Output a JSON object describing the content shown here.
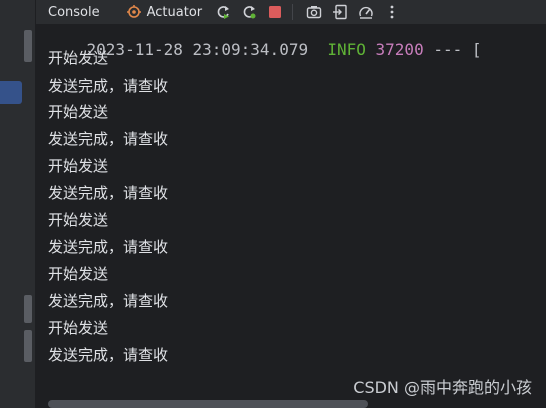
{
  "toolbar": {
    "console_label": "Console",
    "actuator_label": "Actuator"
  },
  "log_header": {
    "timestamp": "2023-11-28 23:09:34.079",
    "level": "INFO",
    "pid": "37200",
    "rest": " --- ["
  },
  "lines": [
    "开始发送",
    "发送完成，请查收",
    "开始发送",
    "发送完成，请查收",
    "开始发送",
    "发送完成，请查收",
    "开始发送",
    "发送完成，请查收",
    "开始发送",
    "发送完成，请查收",
    "开始发送",
    "发送完成，请查收"
  ],
  "watermark": "CSDN @雨中奔跑的小孩",
  "colors": {
    "background": "#1e1f22",
    "toolbar": "#2b2d30",
    "info": "#5fb236",
    "pid": "#c77dbb",
    "stop": "#db5c5c",
    "rerun": "#5fb236"
  },
  "icons": [
    "actuator-icon",
    "rerun-icon",
    "rerun-failed-icon",
    "stop-icon",
    "screenshot-icon",
    "exit-icon",
    "gauge-icon",
    "more-icon"
  ]
}
